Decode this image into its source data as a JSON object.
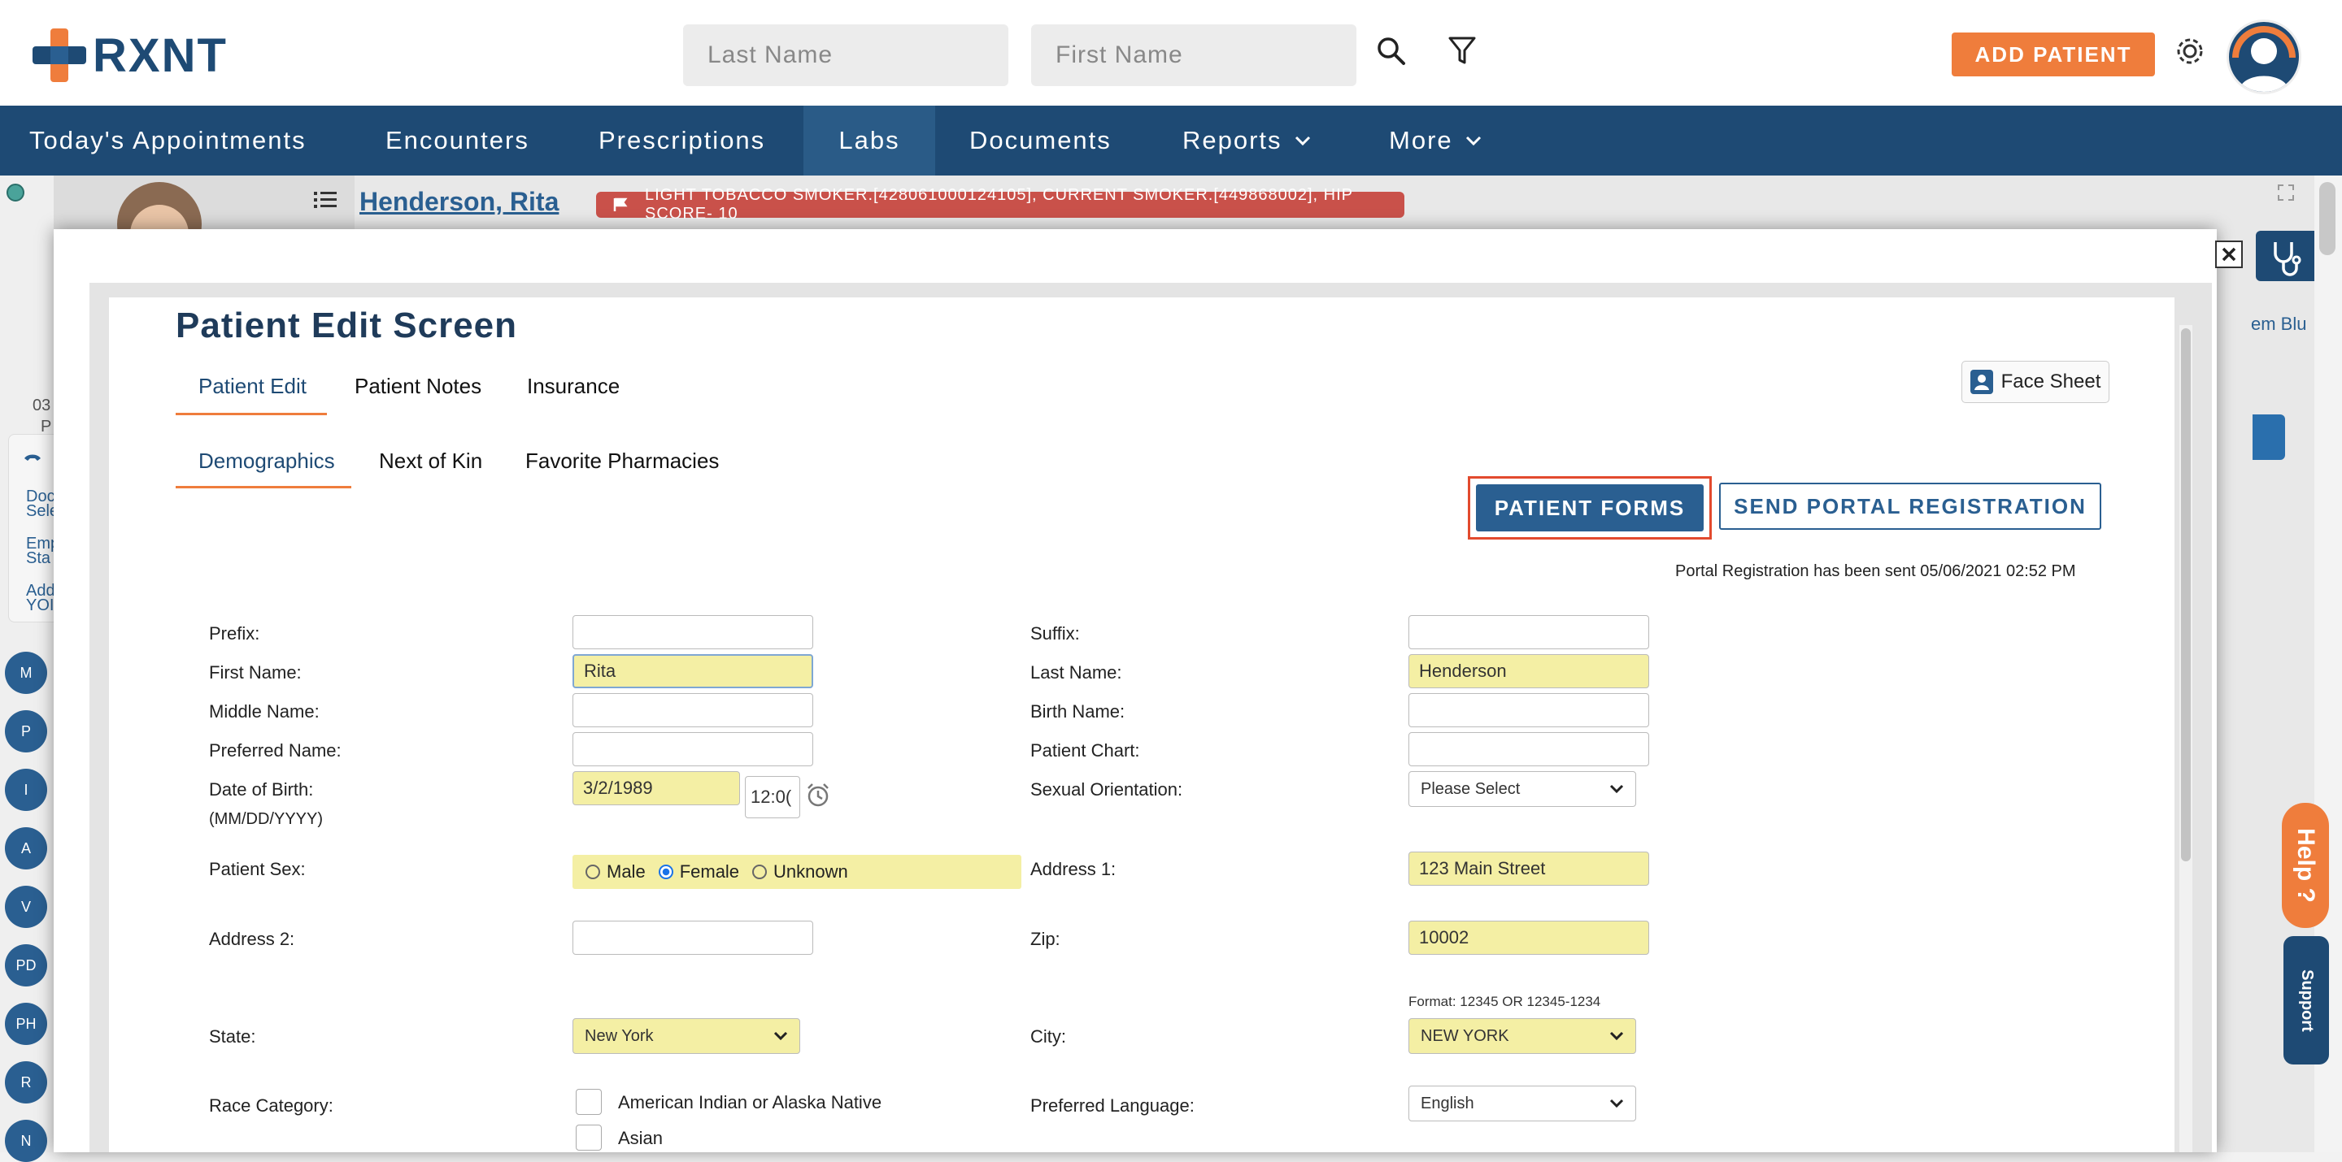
{
  "header": {
    "logo_text": "RXNT",
    "last_name_placeholder": "Last Name",
    "first_name_placeholder": "First Name",
    "add_patient_label": "ADD PATIENT"
  },
  "nav": {
    "items": [
      {
        "label": "Today's Appointments"
      },
      {
        "label": "Encounters"
      },
      {
        "label": "Prescriptions"
      },
      {
        "label": "Labs"
      },
      {
        "label": "Documents"
      },
      {
        "label": "Reports"
      },
      {
        "label": "More"
      }
    ]
  },
  "background": {
    "patient_name": "Henderson, Rita",
    "alert_text": "LIGHT TOBACCO SMOKER.[428061000124105], CURRENT SMOKER.[449868002], HIP SCORE- 10",
    "rail_buttons": [
      "M",
      "P",
      "I",
      "A",
      "V",
      "PD",
      "PH",
      "R",
      "N"
    ],
    "side_link_text": "em Blu",
    "left_fragments": [
      "03",
      "P",
      "Doc",
      "Sele",
      "Emp",
      "Sta",
      "Add",
      "YOI"
    ]
  },
  "modal": {
    "title": "Patient Edit Screen",
    "tabs": [
      "Patient Edit",
      "Patient Notes",
      "Insurance"
    ],
    "subtabs": [
      "Demographics",
      "Next of Kin",
      "Favorite Pharmacies"
    ],
    "face_sheet_label": "Face Sheet",
    "patient_forms_label": "PATIENT FORMS",
    "send_portal_label": "SEND PORTAL REGISTRATION",
    "portal_note": "Portal Registration has been sent 05/06/2021 02:52 PM"
  },
  "form": {
    "prefix_label": "Prefix:",
    "prefix_value": "",
    "suffix_label": "Suffix:",
    "suffix_value": "",
    "first_name_label": "First Name:",
    "first_name_value": "Rita",
    "last_name_label": "Last Name:",
    "last_name_value": "Henderson",
    "middle_name_label": "Middle Name:",
    "middle_name_value": "",
    "birth_name_label": "Birth Name:",
    "birth_name_value": "",
    "preferred_name_label": "Preferred Name:",
    "preferred_name_value": "",
    "patient_chart_label": "Patient Chart:",
    "patient_chart_value": "",
    "dob_label": "Date of Birth:",
    "dob_format": "(MM/DD/YYYY)",
    "dob_value": "3/2/1989",
    "time_value": "12:0(",
    "sexual_orientation_label": "Sexual Orientation:",
    "sexual_orientation_value": "Please Select",
    "patient_sex_label": "Patient Sex:",
    "sex_options": [
      "Male",
      "Female",
      "Unknown"
    ],
    "sex_selected": "Female",
    "address1_label": "Address 1:",
    "address1_value": "123 Main Street",
    "address2_label": "Address 2:",
    "address2_value": "",
    "zip_label": "Zip:",
    "zip_value": "10002",
    "zip_format": "Format: 12345 OR 12345-1234",
    "state_label": "State:",
    "state_value": "New York",
    "city_label": "City:",
    "city_value": "NEW YORK",
    "race_label": "Race Category:",
    "race_options": [
      "American Indian or Alaska Native",
      "Asian"
    ],
    "preferred_language_label": "Preferred Language:",
    "preferred_language_value": "English"
  },
  "widgets": {
    "help_label": "Help ?",
    "support_label": "Support"
  },
  "colors": {
    "brand_orange": "#ef7d3c",
    "nav_blue": "#1e4a74",
    "button_blue": "#2a5f91",
    "highlight_red": "#e24a2e",
    "required_yellow": "#f4efa4"
  }
}
